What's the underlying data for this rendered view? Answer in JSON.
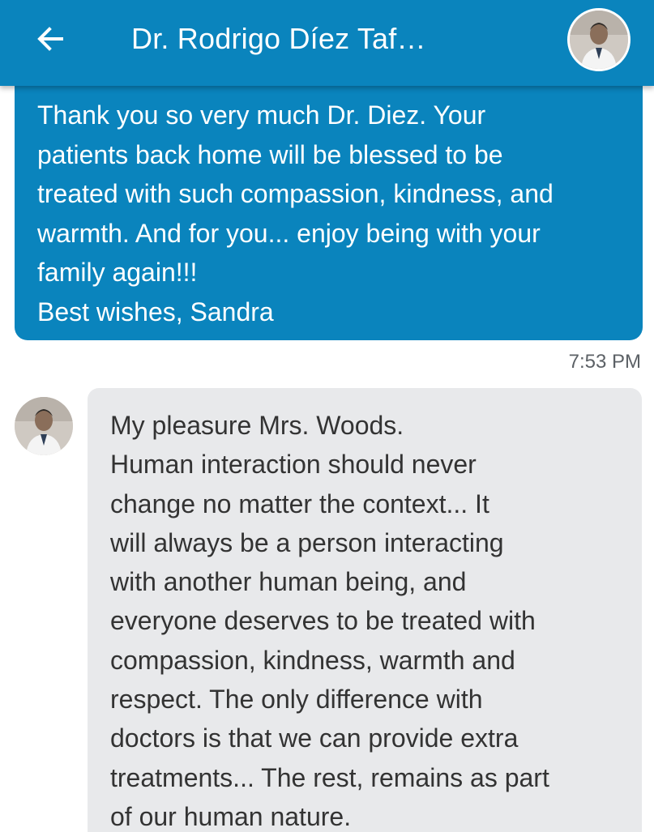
{
  "header": {
    "title": "Dr. Rodrigo Díez Taf…",
    "back_icon": "arrow-left-icon",
    "avatar_icon": "avatar",
    "background": "#0a84bd"
  },
  "messages": [
    {
      "direction": "sent",
      "text": "Thank you so very much Dr. Diez. Your\npatients back home will be blessed to be\ntreated with such compassion, kindness, and\nwarmth. And for you... enjoy being with your\nfamily again!!!\nBest wishes, Sandra",
      "time": "7:53 PM",
      "bubble_color": "#0a84bd"
    },
    {
      "direction": "received",
      "text": "My pleasure Mrs. Woods.\nHuman interaction  should never\nchange no matter the context... It\nwill always be a person interacting\nwith another human being, and\neveryone deserves to be treated with\ncompassion, kindness, warmth and\nrespect. The only difference with\ndoctors is that we can provide extra\ntreatments... The rest, remains as part\nof our human nature.",
      "bubble_color": "#e8e9eb"
    }
  ]
}
